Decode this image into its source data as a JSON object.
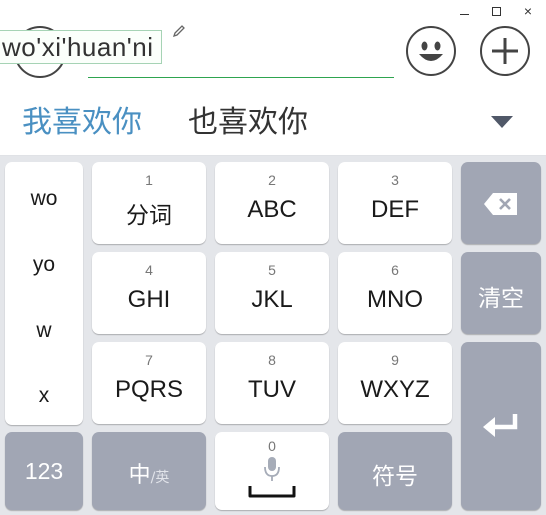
{
  "window": {
    "min_icon": "minimize-icon",
    "max_icon": "maximize-icon",
    "close_glyph": "×"
  },
  "input": {
    "pinyin": "wo'xi'huan'ni"
  },
  "candidates": {
    "items": [
      "我喜欢你",
      "也喜欢你"
    ],
    "colors": {
      "first": "#4a90c2",
      "other": "#333333"
    }
  },
  "left_column": [
    "wo",
    "yo",
    "w",
    "x"
  ],
  "keys": {
    "k1": {
      "num": "1",
      "label": "分词"
    },
    "k2": {
      "num": "2",
      "label": "ABC"
    },
    "k3": {
      "num": "3",
      "label": "DEF"
    },
    "k4": {
      "num": "4",
      "label": "GHI"
    },
    "k5": {
      "num": "5",
      "label": "JKL"
    },
    "k6": {
      "num": "6",
      "label": "MNO"
    },
    "k7": {
      "num": "7",
      "label": "PQRS"
    },
    "k8": {
      "num": "8",
      "label": "TUV"
    },
    "k9": {
      "num": "9",
      "label": "WXYZ"
    },
    "k0": {
      "num": "0"
    }
  },
  "function_keys": {
    "clear": "清空",
    "numbers": "123",
    "lang_main": "中",
    "lang_sub": "/英",
    "symbols": "符号"
  },
  "colors": {
    "key_white": "#ffffff",
    "key_gray": "#a1a6b4",
    "keyboard_bg": "#e4e6ea",
    "underline_green": "#2ea44f"
  }
}
